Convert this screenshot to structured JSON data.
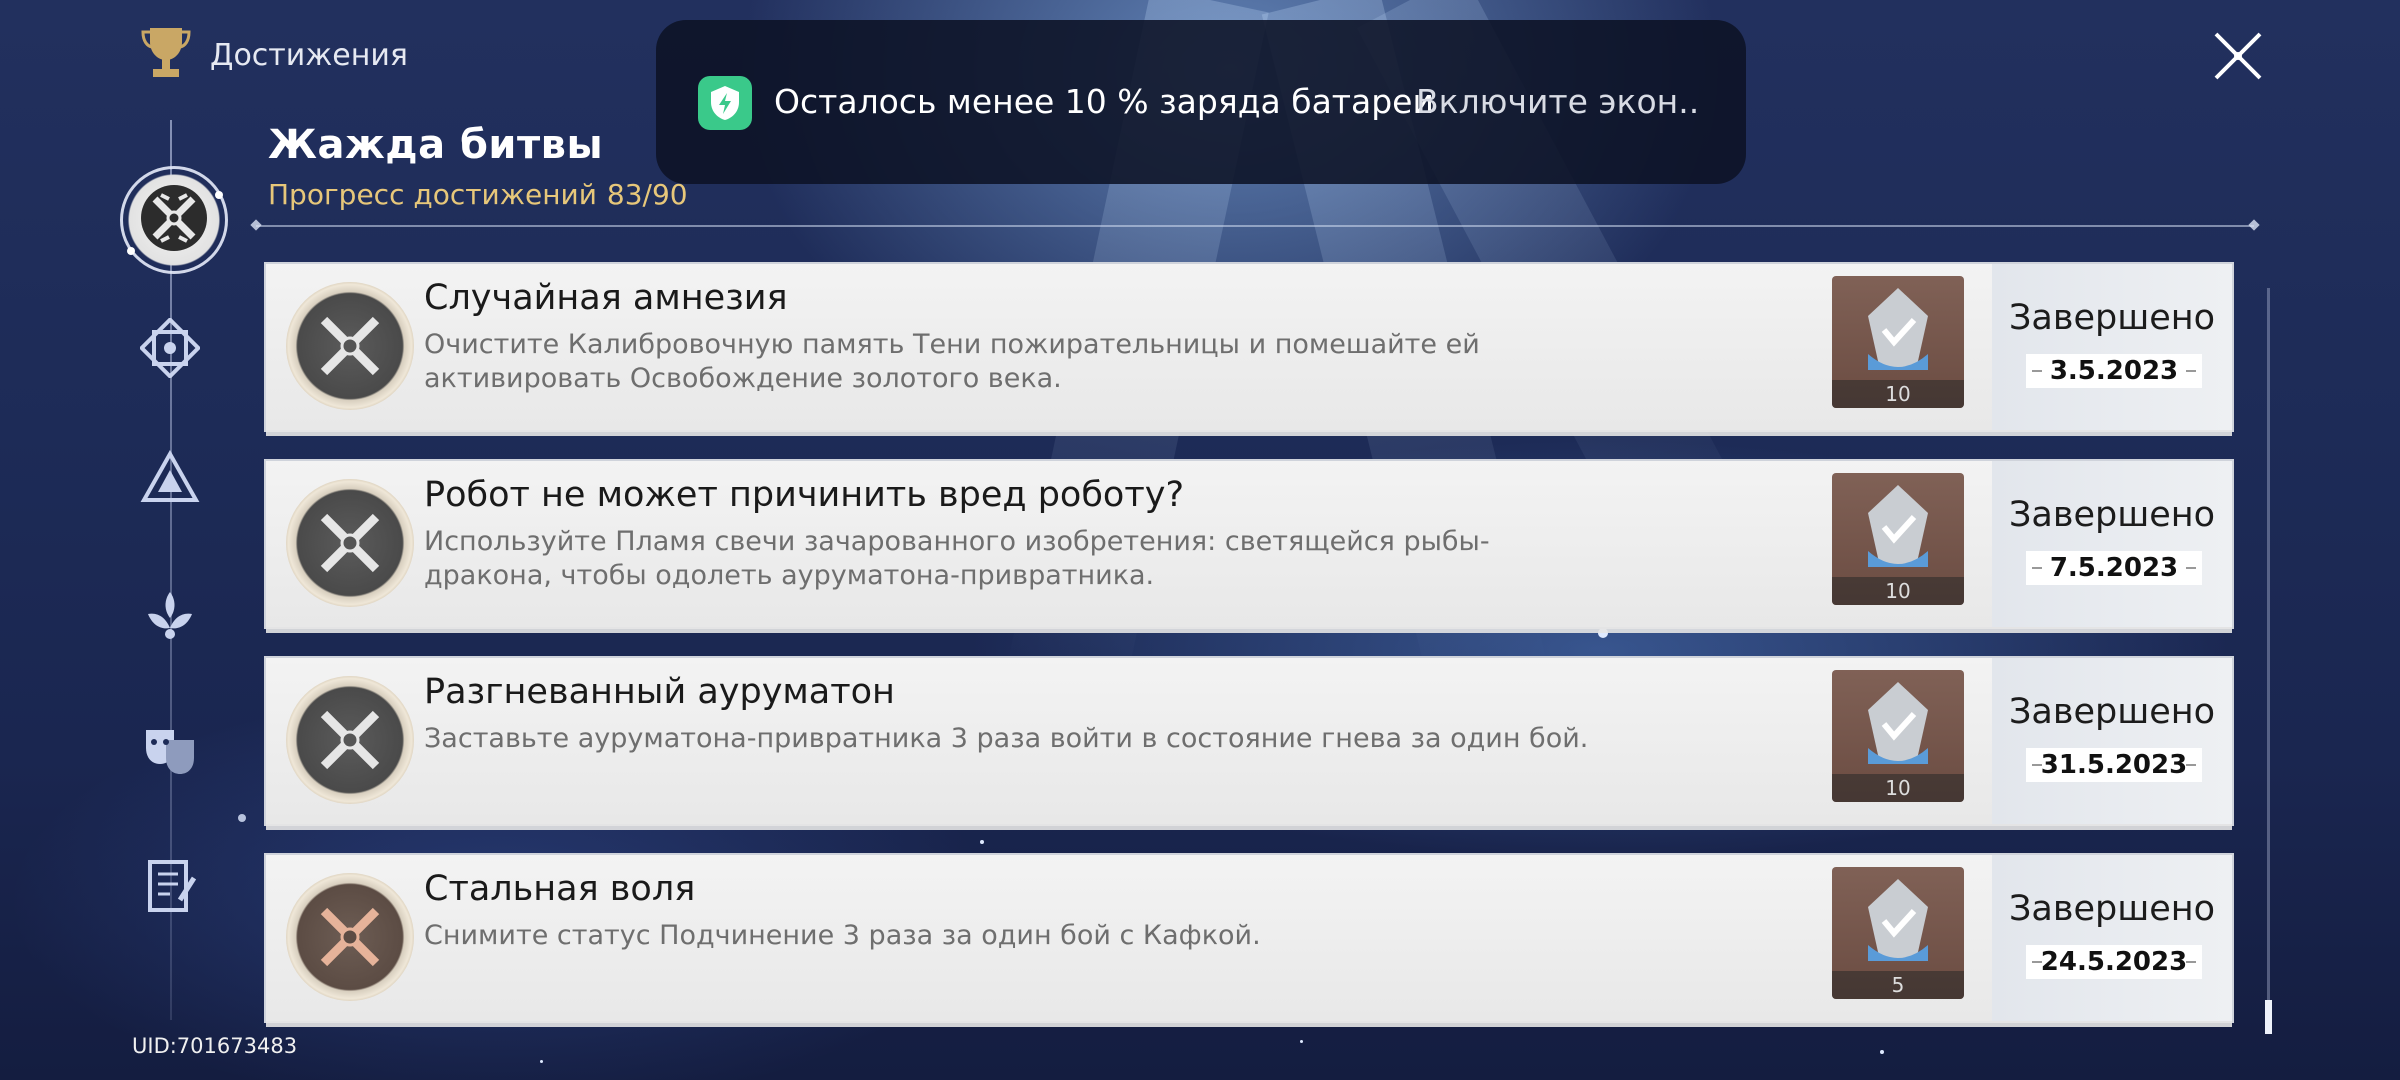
{
  "header": {
    "title": "Достижения",
    "icon": "trophy-icon"
  },
  "section": {
    "title": "Жажда битвы",
    "progress_label": "Прогресс достижений",
    "progress_value": "83/90"
  },
  "rail": {
    "items": [
      {
        "name": "battle-category-icon",
        "active": true
      },
      {
        "name": "emblem-category-icon",
        "active": false
      },
      {
        "name": "triangle-category-icon",
        "active": false
      },
      {
        "name": "lotus-category-icon",
        "active": false
      },
      {
        "name": "masks-category-icon",
        "active": false
      },
      {
        "name": "notebook-category-icon",
        "active": false
      }
    ]
  },
  "achievements": [
    {
      "title": "Случайная амнезия",
      "description": "Очистите Калибровочную память Тени пожирательницы и помешайте ей активировать Освобождение золотого века.",
      "reward_count": "10",
      "status": "Завершено",
      "date": "3.5.2023",
      "badge": "silver"
    },
    {
      "title": "Робот не может причинить вред роботу?",
      "description": "Используйте Пламя свечи зачарованного изобретения: светящейся рыбы-дракона, чтобы одолеть ауруматона-привратника.",
      "reward_count": "10",
      "status": "Завершено",
      "date": "7.5.2023",
      "badge": "silver"
    },
    {
      "title": "Разгневанный ауруматон",
      "description": "Заставьте ауруматона-привратника 3 раза войти в состояние гнева за один бой.",
      "reward_count": "10",
      "status": "Завершено",
      "date": "31.5.2023",
      "badge": "silver"
    },
    {
      "title": "Стальная воля",
      "description": "Снимите статус Подчинение 3 раза за один бой с Кафкой.",
      "reward_count": "5",
      "status": "Завершено",
      "date": "24.5.2023",
      "badge": "bronze"
    }
  ],
  "notification": {
    "text": "Осталось менее 10 % заряда батареи",
    "action": "Включите экон..",
    "icon": "battery-shield-icon",
    "accent": "#3ac98a"
  },
  "footer": {
    "uid": "UID:701673483"
  },
  "colors": {
    "progress": "#e7c77a",
    "card_bg": "#f0f0f0"
  }
}
